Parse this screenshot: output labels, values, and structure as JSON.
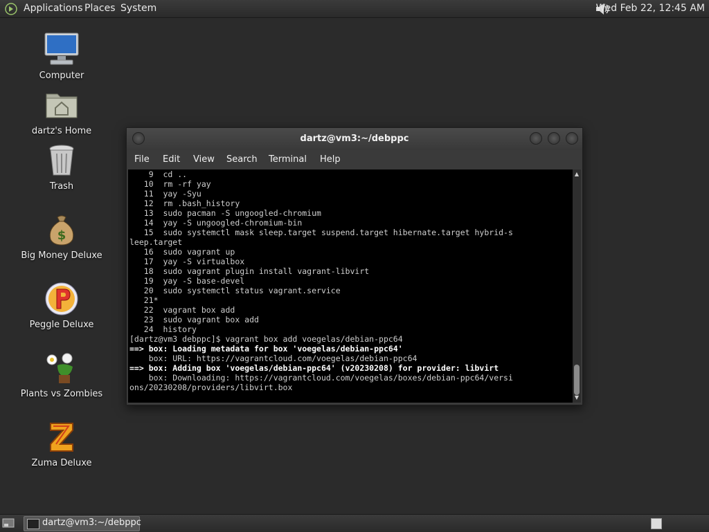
{
  "top_panel": {
    "menus": [
      "Applications",
      "Places",
      "System"
    ],
    "clock": "Wed Feb 22, 12:45 AM",
    "icons": {
      "logo": "gnome-foot-icon",
      "volume": "volume-icon"
    }
  },
  "desktop_icons": [
    {
      "label": "Computer",
      "icon": "computer-icon"
    },
    {
      "label": "dartz's Home",
      "icon": "home-folder-icon"
    },
    {
      "label": "Trash",
      "icon": "trash-icon"
    },
    {
      "label": "Big Money Deluxe",
      "icon": "money-bag-icon"
    },
    {
      "label": "Peggle Deluxe",
      "icon": "peggle-icon"
    },
    {
      "label": "Plants vs Zombies",
      "icon": "plants-icon"
    },
    {
      "label": "Zuma Deluxe",
      "icon": "zuma-icon"
    }
  ],
  "terminal": {
    "title": "dartz@vm3:~/debppc",
    "menu": [
      "File",
      "Edit",
      "View",
      "Search",
      "Terminal",
      "Help"
    ],
    "lines": [
      "    9  cd ..",
      "   10  rm -rf yay",
      "   11  yay -Syu",
      "   12  rm .bash_history",
      "   13  sudo pacman -S ungoogled-chromium",
      "   14  yay -S ungoogled-chromium-bin",
      "   15  sudo systemctl mask sleep.target suspend.target hibernate.target hybrid-s",
      "leep.target",
      "   16  sudo vagrant up",
      "   17  yay -S virtualbox",
      "   18  sudo vagrant plugin install vagrant-libvirt",
      "   19  yay -S base-devel",
      "   20  sudo systemctl status vagrant.service",
      "   21*",
      "   22  vagrant box add",
      "   23  sudo vagrant box add",
      "   24  history",
      "[dartz@vm3 debppc]$ vagrant box add voegelas/debian-ppc64",
      "==> box: Loading metadata for box 'voegelas/debian-ppc64'",
      "    box: URL: https://vagrantcloud.com/voegelas/debian-ppc64",
      "==> box: Adding box 'voegelas/debian-ppc64' (v20230208) for provider: libvirt",
      "    box: Downloading: https://vagrantcloud.com/voegelas/boxes/debian-ppc64/versi",
      "ons/20230208/providers/libvirt.box"
    ],
    "bold_lines": [
      18,
      20
    ]
  },
  "bottom_panel": {
    "task_label": "dartz@vm3:~/debppc"
  }
}
